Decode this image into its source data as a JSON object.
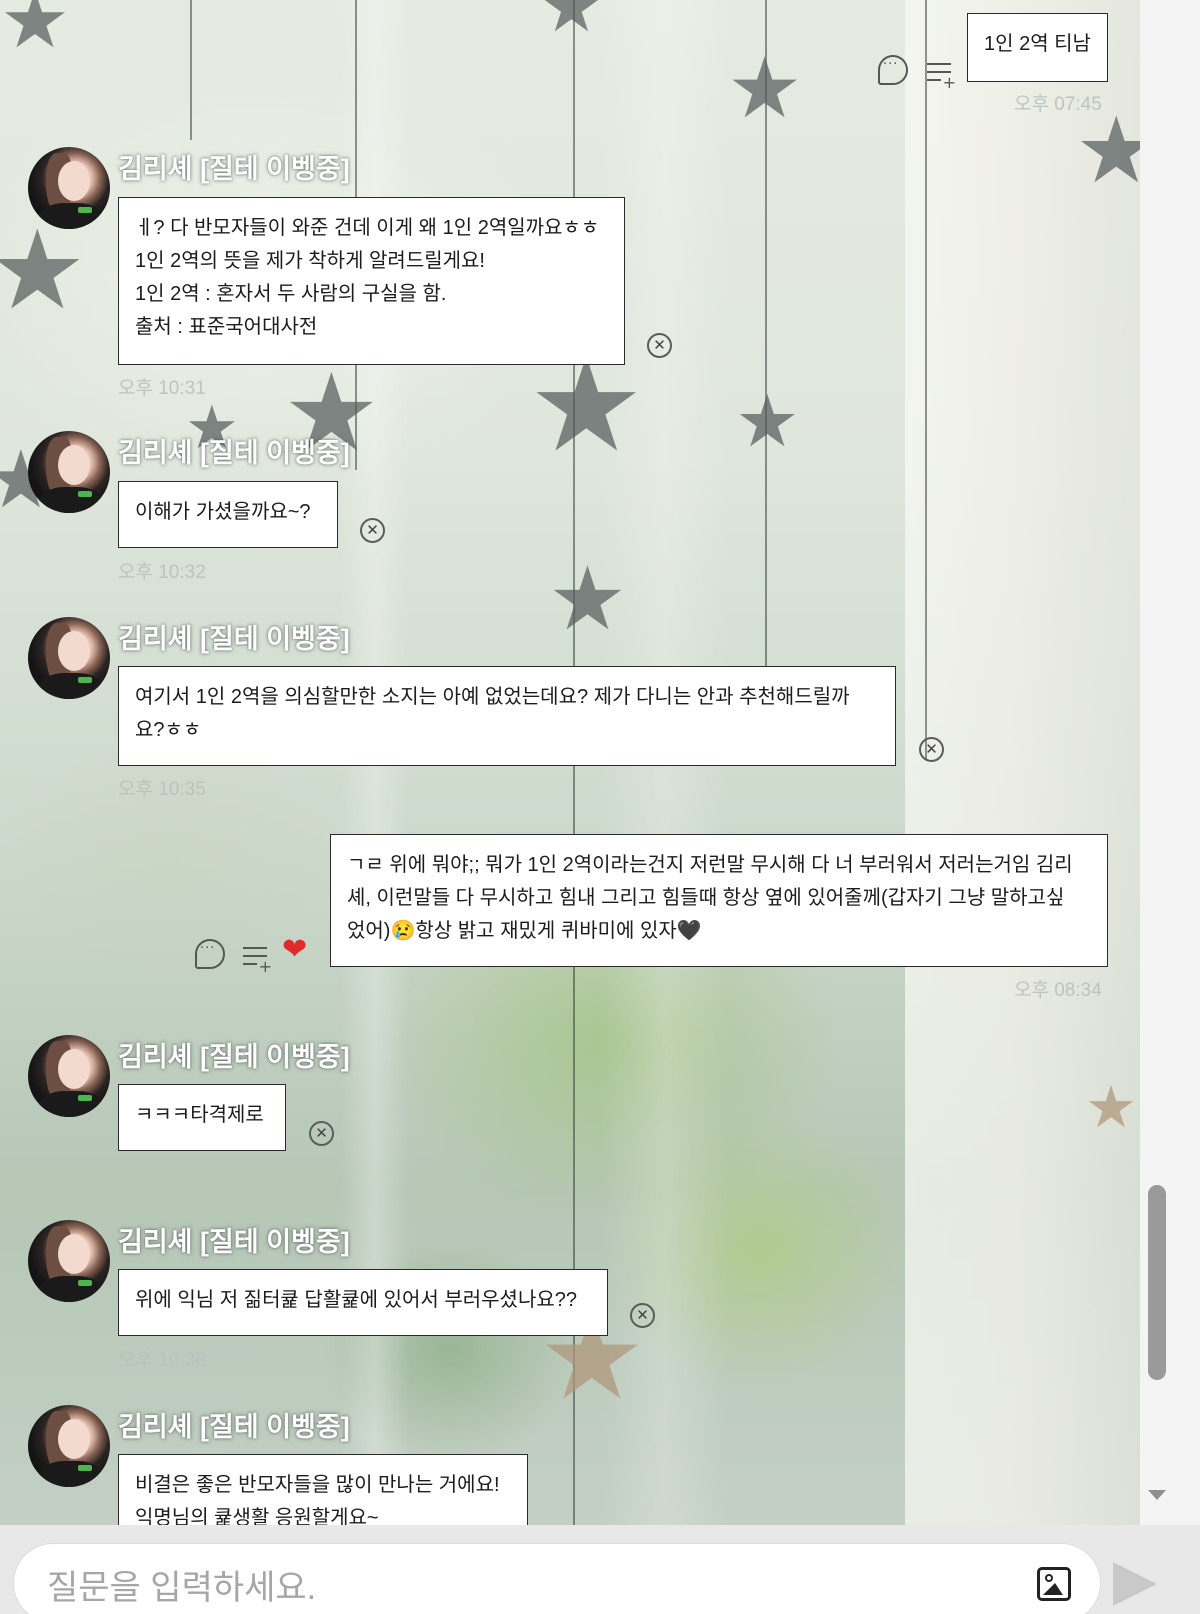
{
  "chat": {
    "sender_name": "김리셰 [질테 이벵중]",
    "incoming": [
      {
        "lines": [
          "ㅔ? 다 반모자들이 와준 건데 이게 왜 1인 2역일까요ㅎㅎ",
          "1인 2역의 뜻을 제가 착하게 알려드릴게요!",
          "1인 2역 : 혼자서 두 사람의 구실을 함.",
          "출처 : 표준국어대사전"
        ],
        "time": "오후 10:31"
      },
      {
        "lines": [
          "이해가 가셨을까요~?"
        ],
        "time": "오후 10:32"
      },
      {
        "lines": [
          "여기서 1인 2역을 의심할만한 소지는 아예 없었는데요? 제가 다니는 안과 추천해드릴까",
          "요?ㅎㅎ"
        ],
        "time": "오후 10:35"
      },
      {
        "lines": [
          "ㅋㅋㅋ타격제로"
        ],
        "time": ""
      },
      {
        "lines": [
          "위에 익님 저 짊터큝 답활큝에 있어서 부러우셨나요??"
        ],
        "time": "오후 10:36"
      },
      {
        "lines": [
          "비결은 좋은 반모자들을 많이 만나는 거에요!",
          "익명님의 큝생활 응원할게요~"
        ],
        "time": ""
      }
    ],
    "outgoing": [
      {
        "lines": [
          "1인 2역 티남"
        ],
        "time": "오후 07:45"
      },
      {
        "lines": [
          "ㄱㄹ 위에 뭐야;; 뭐가 1인 2역이라는건지 저런말 무시해 다 너 부러워서 저러는거임 김리",
          "셰, 이런말들 다 무시하고 힘내 그리고 힘들때 항상 옆에 있어줄께(갑자기 그냥 말하고싶",
          "었어)😢항상 밝고 재밌게 퀴바미에 있자🖤"
        ],
        "time": "오후 08:34"
      }
    ],
    "close_glyph": "✕",
    "heart_glyph": "❤"
  },
  "input": {
    "placeholder": "질문을 입력하세요."
  },
  "icons": {
    "reply": "speech-bubble-icon",
    "list": "list-add-icon",
    "heart": "heart-icon",
    "image": "image-icon",
    "send": "send-icon",
    "close": "close-circle-icon"
  },
  "colors": {
    "heart": "#e12a2a",
    "bubble_bg": "#ffffff",
    "sender_name": "#ffffff",
    "send_disabled": "#c9c9c9"
  }
}
